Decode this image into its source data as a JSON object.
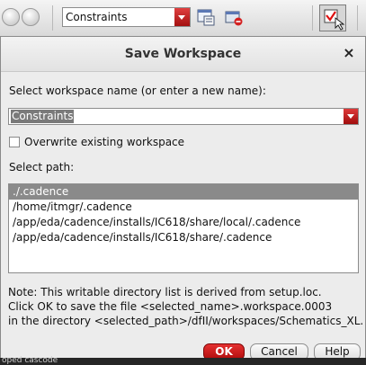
{
  "toolbar": {
    "combo_value": "Constraints",
    "icons": [
      "circle-button-icon",
      "circle-button-icon",
      "workspace-icon",
      "camera-icon",
      "checklist-icon"
    ]
  },
  "dialog": {
    "title": "Save Workspace",
    "close_label": "×",
    "select_name_label": "Select workspace name (or enter a new name):",
    "name_value": "Constraints",
    "overwrite_label": "Overwrite existing workspace",
    "select_path_label": "Select path:",
    "paths": [
      "./.cadence",
      "/home/itmgr/.cadence",
      "/app/eda/cadence/installs/IC618/share/local/.cadence",
      "/app/eda/cadence/installs/IC618/share/.cadence"
    ],
    "note_lines": [
      "Note: This writable directory list is derived from setup.loc.",
      "Click OK to save the file <selected_name>.workspace.0003",
      "in the directory <selected_path>/dfII/workspaces/Schematics_XL."
    ],
    "buttons": {
      "ok": "OK",
      "cancel": "Cancel",
      "help": "Help"
    },
    "colors": {
      "accent_red": "#c41414",
      "selection_gray": "#8a8a8a"
    }
  },
  "background_peek_text": "oped cascode"
}
